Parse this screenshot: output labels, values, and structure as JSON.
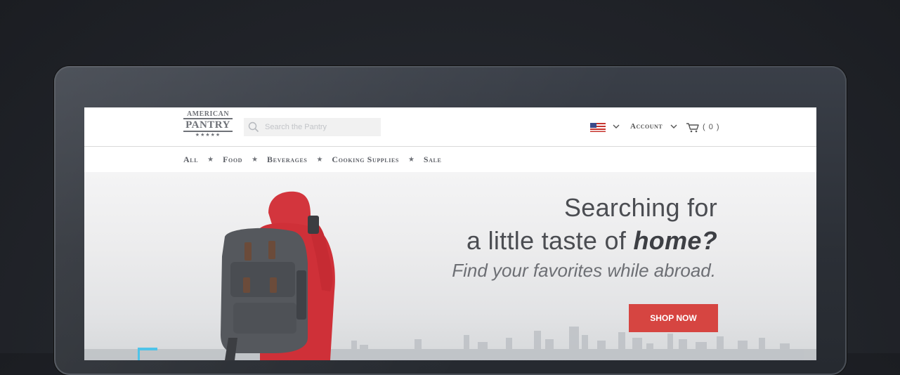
{
  "header": {
    "logo": {
      "top": "AMERICAN",
      "main": "PANTRY",
      "stars": "★★★★★"
    },
    "search": {
      "placeholder": "Search the Pantry"
    },
    "account_label": "Account",
    "cart_count": "( 0 )"
  },
  "nav": {
    "items": [
      "All",
      "Food",
      "Beverages",
      "Cooking Supplies",
      "Sale"
    ],
    "separator": "★"
  },
  "hero": {
    "headline_line1": "Searching for",
    "headline_line2_prefix": "a little taste of ",
    "headline_line2_emphasis": "home?",
    "subline": "Find your favorites while abroad.",
    "cta_label": "SHOP NOW"
  },
  "colors": {
    "accent": "#d64541",
    "text": "#4b4d52",
    "frame": "#2b2f36"
  }
}
